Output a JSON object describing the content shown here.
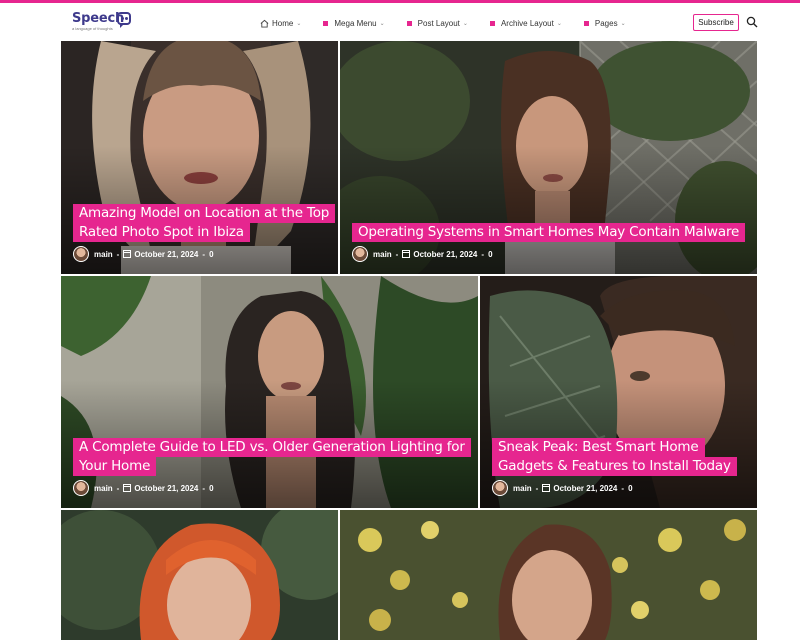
{
  "brand": {
    "name": "Speech",
    "tagline": "a language of thoughts"
  },
  "nav": {
    "items": [
      {
        "label": "Home",
        "has_menu": true
      },
      {
        "label": "Mega Menu",
        "has_menu": true
      },
      {
        "label": "Post Layout",
        "has_menu": true
      },
      {
        "label": "Archive Layout",
        "has_menu": true
      },
      {
        "label": "Pages",
        "has_menu": true
      }
    ],
    "subscribe_label": "Subscribe",
    "search_icon": "search-icon"
  },
  "colors": {
    "accent": "#e6268f",
    "brand": "#3e3a8c"
  },
  "posts": [
    {
      "title": "Amazing Model on Location at the Top Rated Photo Spot in Ibiza",
      "author": "main",
      "date": "October 21, 2024",
      "comments": "0"
    },
    {
      "title": "Operating Systems in Smart Homes May Contain Malware",
      "author": "main",
      "date": "October 21, 2024",
      "comments": "0"
    },
    {
      "title": "A Complete Guide to LED vs. Older Generation Lighting for Your Home",
      "author": "main",
      "date": "October 21, 2024",
      "comments": "0"
    },
    {
      "title": "Sneak Peak: Best Smart Home Gadgets & Features to Install Today",
      "author": "main",
      "date": "October 21, 2024",
      "comments": "0"
    }
  ]
}
